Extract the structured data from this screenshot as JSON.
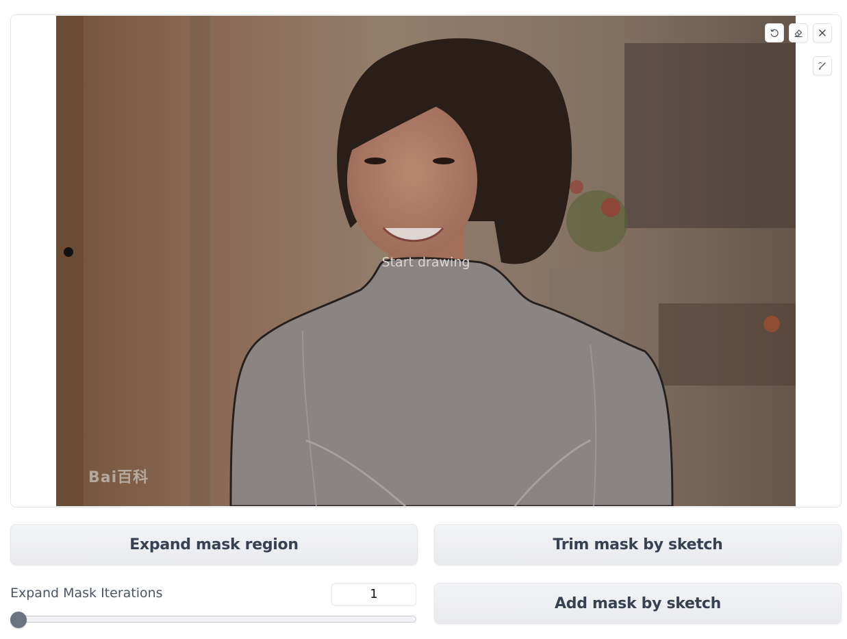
{
  "editor": {
    "hint": "Start drawing",
    "watermark": "Bai百科",
    "tools": {
      "undo": "undo-icon",
      "erase": "eraser-icon",
      "close": "close-icon",
      "brush": "brush-icon"
    }
  },
  "buttons": {
    "expand_mask": "Expand mask region",
    "trim_mask": "Trim mask by sketch",
    "add_mask": "Add mask by sketch"
  },
  "slider": {
    "label": "Expand Mask Iterations",
    "value": "1"
  }
}
